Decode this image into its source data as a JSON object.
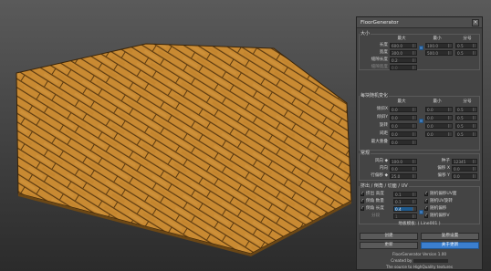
{
  "panel": {
    "title": "FloorGenerator",
    "close_glyph": "×",
    "size": {
      "title": "大小",
      "col_max": "最大",
      "col_min": "最小",
      "col_div": "分号",
      "rows": [
        {
          "label": "长度",
          "max": "600.0",
          "min": "100.0",
          "div": "0.5"
        },
        {
          "label": "宽度",
          "max": "300.0",
          "min": "500.0",
          "div": "0.5"
        },
        {
          "label": "缝隙长度",
          "max": "0.2",
          "min": "",
          "div": ""
        },
        {
          "label": "缝隙宽度",
          "max": "0.0",
          "min": "",
          "div": ""
        }
      ]
    },
    "random": {
      "title": "每块随机变化",
      "col_max": "最大",
      "col_min": "最小",
      "col_div": "分号",
      "rows": [
        {
          "label": "倾斜X",
          "max": "0.0",
          "min": "0.0",
          "div": "0.5"
        },
        {
          "label": "倾斜Y",
          "max": "0.0",
          "min": "0.0",
          "div": "0.5"
        },
        {
          "label": "旋转",
          "max": "0.0",
          "min": "0.0",
          "div": "0.5"
        },
        {
          "label": "间距",
          "max": "0.0",
          "min": "0.0",
          "div": "0.5"
        },
        {
          "label": "最大重叠",
          "max": "0.0",
          "min": "",
          "div": ""
        }
      ]
    },
    "general": {
      "title": "常规",
      "rows": [
        {
          "label": "风向 ◆",
          "value": "100.0",
          "label2": "种子",
          "value2": "12345"
        },
        {
          "label": "内向",
          "value": "0.0",
          "label2": "偏移 X",
          "value2": "0.0"
        },
        {
          "label": "行偏移 ◆",
          "value": "25.0",
          "label2": "偏移 Y",
          "value2": "0.0"
        }
      ]
    },
    "bevel": {
      "title": "挤出 / 倒角 / 切面 / UV",
      "rows": [
        {
          "label": "挤出 高度",
          "value": "0.1",
          "right": "随机偏移UV面"
        },
        {
          "label": "倒角 数量",
          "value": "0.1",
          "right": "随机UV旋转"
        },
        {
          "label": "倒角 长度",
          "value": "0.4",
          "right": "随机偏移"
        },
        {
          "label": "分段",
          "value": "1",
          "right": "随机偏移V"
        }
      ]
    },
    "target": "地板模板: ( Line001 )",
    "buttons": {
      "create": "创建",
      "reset": "复原设置",
      "update": "更新",
      "about": "关于更新"
    },
    "footer": {
      "version": "FloorGenerator Version 1.00",
      "created_by": "Created by",
      "source": "The source to HighQuality textures"
    }
  }
}
